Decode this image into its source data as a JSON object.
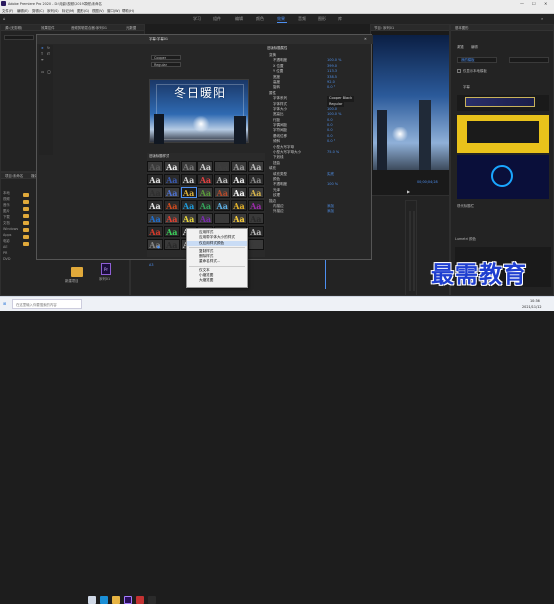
{
  "titlebar": {
    "title": "Adobe Premiere Pro 2020 - D:\\电影\\视频\\2019寒假\\未命名"
  },
  "menubar": {
    "items": [
      "文件(F)",
      "编辑(E)",
      "剪辑(C)",
      "序列(S)",
      "标记(M)",
      "图形(G)",
      "视图(V)",
      "窗口(W)",
      "帮助(H)"
    ]
  },
  "workspace": {
    "tabs": [
      "学习",
      "组件",
      "编辑",
      "颜色",
      "效果",
      "音频",
      "图形",
      "库"
    ],
    "active": "效果"
  },
  "source_panel": {
    "tabs": [
      "源:(无剪辑)",
      "效果控件",
      "音频剪辑混合器:序列01",
      "元数据"
    ]
  },
  "program": {
    "tab": "节目: 序列01",
    "timecode": "00;00;04;28"
  },
  "legacy_title": {
    "window_title": "字幕:字幕01",
    "font_family": "Cooper",
    "font_style": "Regular",
    "title_text": "冬日暖阳",
    "styles_header": "旧版标题样式",
    "style_glyph": "Aa"
  },
  "properties": {
    "header": "旧版标题属性",
    "rows": [
      {
        "label": "变换",
        "value": ""
      },
      {
        "label": "不透明度",
        "value": "100.0 %"
      },
      {
        "label": "X 位置",
        "value": "399.0"
      },
      {
        "label": "Y 位置",
        "value": "113.3"
      },
      {
        "label": "宽度",
        "value": "338.5"
      },
      {
        "label": "高度",
        "value": "92.0"
      },
      {
        "label": "旋转",
        "value": "0.0 °"
      },
      {
        "label": "属性",
        "value": ""
      },
      {
        "label": "字体系列",
        "value": "Cooper Black"
      },
      {
        "label": "字体样式",
        "value": "Regular"
      },
      {
        "label": "字体大小",
        "value": "100.0"
      },
      {
        "label": "宽高比",
        "value": "100.0 %"
      },
      {
        "label": "行距",
        "value": "0.0"
      },
      {
        "label": "字偶间距",
        "value": "0.0"
      },
      {
        "label": "字符间距",
        "value": "0.0"
      },
      {
        "label": "基线位移",
        "value": "0.0"
      },
      {
        "label": "倾斜",
        "value": "0.0 °"
      },
      {
        "label": "小型大写字母",
        "value": ""
      },
      {
        "label": "小型大写字母大小",
        "value": "75.0 %"
      },
      {
        "label": "下划线",
        "value": ""
      },
      {
        "label": "扭曲",
        "value": ""
      },
      {
        "label": "填充",
        "value": ""
      },
      {
        "label": "填充类型",
        "value": "实底"
      },
      {
        "label": "颜色",
        "value": ""
      },
      {
        "label": "不透明度",
        "value": "100 %"
      },
      {
        "label": "光泽",
        "value": ""
      },
      {
        "label": "纹理",
        "value": ""
      },
      {
        "label": "描边",
        "value": ""
      },
      {
        "label": "内描边",
        "value": "添加"
      },
      {
        "label": "外描边",
        "value": "添加"
      }
    ]
  },
  "context_menu": {
    "items": [
      "应用样式",
      "应用带字体大小的样式",
      "仅应用样式颜色",
      "复制样式",
      "删除样式",
      "重命名样式...",
      "仅文本",
      "小缩览图",
      "大缩览图"
    ],
    "selected": "仅应用样式颜色"
  },
  "project": {
    "tabs": [
      "项目:未命名",
      "媒体浏览器",
      "库"
    ],
    "folders": [
      "本地",
      "视频",
      "音乐",
      "图片",
      "下载",
      "文档",
      "Windows",
      "Apps",
      "电影",
      "AE",
      "PR",
      "DVD"
    ],
    "clips": [
      {
        "name": "Adobe_Premie..."
      },
      {
        "name": "",
        "kind": "image"
      },
      {
        "name": "新建项目"
      },
      {
        "name": "序列01",
        "kind": "pr"
      }
    ]
  },
  "timeline": {
    "tab": "序列01",
    "tracks": [
      "V3",
      "V2",
      "V1",
      "A1",
      "A2",
      "A3"
    ]
  },
  "essential_graphics": {
    "header": "基本图形",
    "tabs": [
      "浏览",
      "编辑"
    ],
    "dropdown": "我的模板",
    "checkbox": "仅显示本地模板",
    "item1": "字幕",
    "section": "图形",
    "templates": [
      "现代标题栏",
      "",
      "现代标题",
      "现代标题栏"
    ],
    "caption_label": "现代标题栏",
    "bottom_panel": "Lumetri 颜色"
  },
  "taskbar": {
    "time": "10:36",
    "date": "2021/11/12",
    "search": "在这里输入你要搜索的内容"
  },
  "watermark": "最需教育"
}
